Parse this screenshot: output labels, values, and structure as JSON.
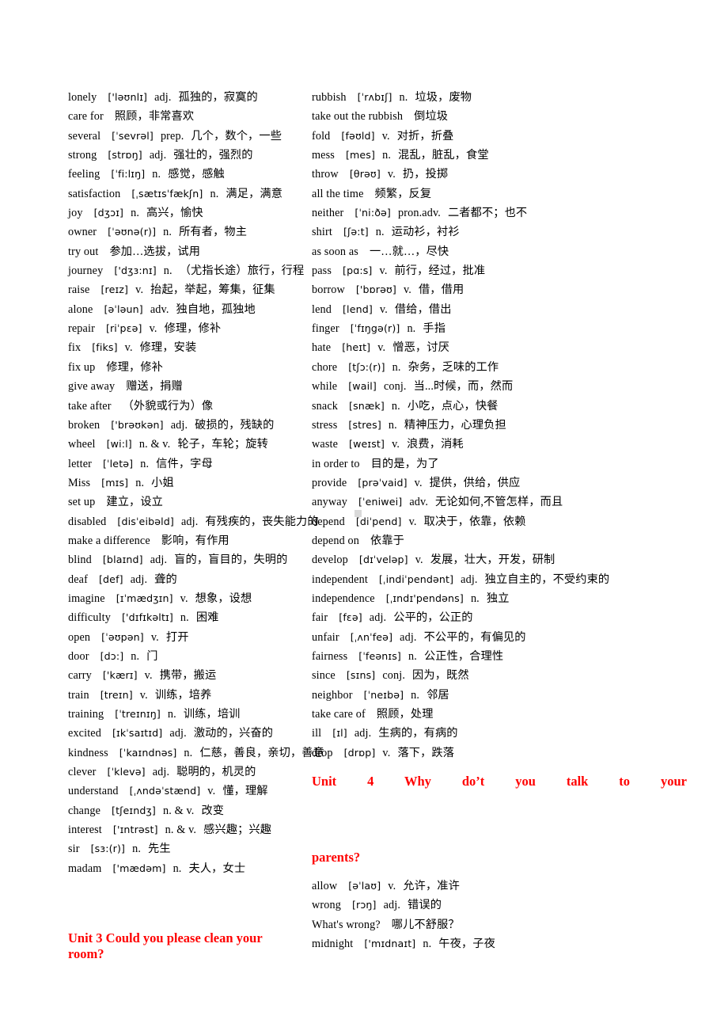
{
  "document": {
    "type": "vocabulary-glossary",
    "language_pair": "English-Chinese",
    "page_background": "#ffffff",
    "heading_color": "#ff0000",
    "body_color": "#000000"
  },
  "left_column": {
    "entries": [
      {
        "word": "lonely",
        "phonetic": "['ləʊnlɪ]",
        "pos": "adj.",
        "meaning": "孤独的，寂寞的"
      },
      {
        "word": "care for",
        "phonetic": "",
        "pos": "",
        "meaning": "照顾，非常喜欢"
      },
      {
        "word": "several",
        "phonetic": "[ˈsevrəl]",
        "pos": "prep.",
        "meaning": "几个，数个，一些"
      },
      {
        "word": "strong",
        "phonetic": "[strɒŋ]",
        "pos": "adj.",
        "meaning": "强壮的，强烈的"
      },
      {
        "word": "feeling",
        "phonetic": "[ˈfi:lɪŋ]",
        "pos": "n.",
        "meaning": "感觉，感触"
      },
      {
        "word": "satisfaction",
        "phonetic": "[ˌsætɪsˈfækʃn]",
        "pos": "n.",
        "meaning": "满足，满意"
      },
      {
        "word": "joy",
        "phonetic": "[dʒɔɪ]",
        "pos": "n.",
        "meaning": "高兴，愉快"
      },
      {
        "word": "owner",
        "phonetic": "[ˈəʊnə(r)]",
        "pos": "n.",
        "meaning": "所有者，物主"
      },
      {
        "word": "try out",
        "phonetic": "",
        "pos": "",
        "meaning": "参加…选拔，试用"
      },
      {
        "word": "journey",
        "phonetic": "['dʒɜ:nɪ]",
        "pos": "n.",
        "meaning": "（尤指长途）旅行，行程"
      },
      {
        "word": "raise",
        "phonetic": "[reɪz]",
        "pos": "v.",
        "meaning": "抬起，举起，筹集，征集"
      },
      {
        "word": "alone",
        "phonetic": "[əˈləun]",
        "pos": "adv.",
        "meaning": "独自地，孤独地"
      },
      {
        "word": "repair",
        "phonetic": "[riˈpɛə]",
        "pos": "v.",
        "meaning": "修理，修补"
      },
      {
        "word": "fix",
        "phonetic": "[fiks]",
        "pos": "v.",
        "meaning": "修理，安装"
      },
      {
        "word": "fix up",
        "phonetic": "",
        "pos": "",
        "meaning": "修理，修补"
      },
      {
        "word": "give away",
        "phonetic": "",
        "pos": "",
        "meaning": "赠送，捐赠"
      },
      {
        "word": "take after",
        "phonetic": "",
        "pos": "",
        "meaning": "（外貌或行为）像"
      },
      {
        "word": "broken",
        "phonetic": "['brəʊkən]",
        "pos": "adj.",
        "meaning": "破损的，残缺的"
      },
      {
        "word": "wheel",
        "phonetic": "[wi:l]",
        "pos": "n. & v.",
        "meaning": "轮子，车轮；旋转"
      },
      {
        "word": "letter",
        "phonetic": "[ˈletə]",
        "pos": "n.",
        "meaning": "信件，字母"
      },
      {
        "word": "Miss",
        "phonetic": "[mɪs]",
        "pos": "n.",
        "meaning": "小姐"
      },
      {
        "word": "set up",
        "phonetic": "",
        "pos": "",
        "meaning": "建立，设立"
      },
      {
        "word": "disabled",
        "phonetic": "[disˈeibəld]",
        "pos": "adj.",
        "meaning": "有残疾的，丧失能力的"
      },
      {
        "word": "make a difference",
        "phonetic": "",
        "pos": "",
        "meaning": "影响，有作用"
      },
      {
        "word": "blind",
        "phonetic": "[blaɪnd]",
        "pos": "adj.",
        "meaning": "盲的，盲目的，失明的"
      },
      {
        "word": "deaf",
        "phonetic": "[def]",
        "pos": "adj.",
        "meaning": "聋的"
      },
      {
        "word": "imagine",
        "phonetic": "[ɪˈmædʒɪn]",
        "pos": "v.",
        "meaning": "想象，设想"
      },
      {
        "word": "difficulty",
        "phonetic": "['dɪfɪkəltɪ]",
        "pos": "n.",
        "meaning": "困难"
      },
      {
        "word": "open",
        "phonetic": "[ˈəʊpən]",
        "pos": "v.",
        "meaning": "打开"
      },
      {
        "word": "door",
        "phonetic": "[dɔ:]",
        "pos": "n.",
        "meaning": "门"
      },
      {
        "word": "carry",
        "phonetic": "['kærɪ]",
        "pos": "v.",
        "meaning": "携带，搬运"
      },
      {
        "word": "train",
        "phonetic": "[treɪn]",
        "pos": "v.",
        "meaning": "训练，培养"
      },
      {
        "word": "training",
        "phonetic": "[ˈtreɪnɪŋ]",
        "pos": "n.",
        "meaning": "训练，培训"
      },
      {
        "word": "excited",
        "phonetic": "[ɪkˈsaɪtɪd]",
        "pos": "adj.",
        "meaning": "激动的，兴奋的"
      },
      {
        "word": "kindness",
        "phonetic": "[ˈkaɪndnəs]",
        "pos": "n.",
        "meaning": "仁慈，善良，亲切，善意"
      },
      {
        "word": "clever",
        "phonetic": "[ˈklevə]",
        "pos": "adj.",
        "meaning": "聪明的，机灵的"
      },
      {
        "word": "understand",
        "phonetic": "[ˌʌndəˈstænd]",
        "pos": "v.",
        "meaning": "懂，理解"
      },
      {
        "word": "change",
        "phonetic": "[tʃeɪndʒ]",
        "pos": "n. & v.",
        "meaning": "改变"
      },
      {
        "word": "interest",
        "phonetic": "['ɪntrəst]",
        "pos": "n. & v.",
        "meaning": "感兴趣；兴趣"
      },
      {
        "word": "sir",
        "phonetic": "[sɜ:(r)]",
        "pos": "n.",
        "meaning": "先生"
      },
      {
        "word": "madam",
        "phonetic": "['mædəm]",
        "pos": "n.",
        "meaning": "夫人，女士"
      }
    ],
    "unit_heading": "Unit 3 Could you please clean your room?"
  },
  "right_column": {
    "entries": [
      {
        "word": " rubbish",
        "phonetic": "[ˈrʌbɪʃ]",
        "pos": "n.",
        "meaning": "垃圾，废物"
      },
      {
        "word": "take out the rubbish",
        "phonetic": "",
        "pos": "",
        "meaning": "倒垃圾"
      },
      {
        "word": "fold",
        "phonetic": "[fəʊld]",
        "pos": "v.",
        "meaning": "对折，折叠"
      },
      {
        "word": "mess",
        "phonetic": "[mes]",
        "pos": "n.",
        "meaning": "混乱，脏乱，食堂"
      },
      {
        "word": "throw",
        "phonetic": "[θrəʊ]",
        "pos": "v.",
        "meaning": "扔，投掷"
      },
      {
        "word": "all the time",
        "phonetic": "",
        "pos": "",
        "meaning": "频繁，反复"
      },
      {
        "word": "neither",
        "phonetic": "[ˈni:ðə]",
        "pos": "pron.adv.",
        "meaning": "二者都不；也不"
      },
      {
        "word": "shirt",
        "phonetic": "[ʃə:t]",
        "pos": "n.",
        "meaning": "运动衫，衬衫"
      },
      {
        "word": "as soon as",
        "phonetic": "",
        "pos": "",
        "meaning": "一…就…，尽快"
      },
      {
        "word": "pass",
        "phonetic": "[pɑ:s]",
        "pos": "v.",
        "meaning": "前行，经过，批准"
      },
      {
        "word": "borrow",
        "phonetic": "['bɒrəʊ]",
        "pos": "v.",
        "meaning": "借，借用"
      },
      {
        "word": "lend",
        "phonetic": "[lend]",
        "pos": "v.",
        "meaning": "借给，借出"
      },
      {
        "word": "finger",
        "phonetic": "[ˈfɪŋgə(r)]",
        "pos": "n.",
        "meaning": "手指"
      },
      {
        "word": "hate",
        "phonetic": "[heɪt]",
        "pos": "v.",
        "meaning": "憎恶，讨厌"
      },
      {
        "word": "chore",
        "phonetic": "[tʃɔ:(r)]",
        "pos": "n.",
        "meaning": "杂务，乏味的工作"
      },
      {
        "word": "while",
        "phonetic": "[wail]",
        "pos": "conj.",
        "meaning": "当...时候，而，然而"
      },
      {
        "word": "snack",
        "phonetic": "[snæk]",
        "pos": "n.",
        "meaning": "小吃，点心，快餐"
      },
      {
        "word": "stress",
        "phonetic": "[stres]",
        "pos": "n.",
        "meaning": "精神压力，心理负担"
      },
      {
        "word": "waste",
        "phonetic": "[weɪst]",
        "pos": "v.",
        "meaning": "浪费，消耗"
      },
      {
        "word": "in order to",
        "phonetic": "",
        "pos": "",
        "meaning": "目的是，为了"
      },
      {
        "word": "provide",
        "phonetic": "[prəˈvaid]",
        "pos": "v.",
        "meaning": "提供，供给，供应"
      },
      {
        "word": "anyway",
        "phonetic": "[ˈeniwei]",
        "pos": "adv.",
        "meaning": "无论如何,不管怎样，而且"
      },
      {
        "word": "depend",
        "phonetic": "[diˈpend]",
        "pos": "v.",
        "meaning": "取决于，依靠，依赖"
      },
      {
        "word": "depend on",
        "phonetic": "",
        "pos": "",
        "meaning": "依靠于"
      },
      {
        "word": "develop",
        "phonetic": "[dɪˈveləp]",
        "pos": "v.",
        "meaning": "发展，壮大，开发，研制"
      },
      {
        "word": "independent",
        "phonetic": "[ˌindiˈpendənt]",
        "pos": "adj.",
        "meaning": "独立自主的，不受约束的",
        "wraps": true
      },
      {
        "word": "independence",
        "phonetic": "[ˌɪndɪ'pendəns]",
        "pos": "n.",
        "meaning": "独立"
      },
      {
        "word": "fair",
        "phonetic": "[fɛə]",
        "pos": "adj.",
        "meaning": "公平的，公正的"
      },
      {
        "word": "unfair",
        "phonetic": "[ˌʌnˈfeə]",
        "pos": "adj.",
        "meaning": "不公平的，有偏见的"
      },
      {
        "word": "fairness",
        "phonetic": "[ˈfeənɪs]",
        "pos": "n.",
        "meaning": "公正性，合理性"
      },
      {
        "word": "since",
        "phonetic": "[sɪns]",
        "pos": "conj.",
        "meaning": "因为，既然"
      },
      {
        "word": "neighbor",
        "phonetic": "[ˈneɪbə]",
        "pos": "n.",
        "meaning": "邻居"
      },
      {
        "word": "take care of",
        "phonetic": "",
        "pos": "",
        "meaning": "照顾，处理"
      },
      {
        "word": "ill",
        "phonetic": "[ɪl]",
        "pos": "adj.",
        "meaning": "生病的，有病的"
      },
      {
        "word": "drop",
        "phonetic": "[drɒp]",
        "pos": "v.",
        "meaning": "落下，跌落"
      }
    ],
    "unit_heading_line1": "Unit 4 Why do’t you talk to your",
    "unit_heading_line2": "parents?",
    "entries_after_heading": [
      {
        "word": " allow",
        "phonetic": "[əˈlaʊ]",
        "pos": "v.",
        "meaning": "允许，准许"
      },
      {
        "word": "wrong",
        "phonetic": "[rɔŋ]",
        "pos": "adj.",
        "meaning": "错误的"
      },
      {
        "word": "What's wrong?",
        "phonetic": "",
        "pos": "",
        "meaning": "哪儿不舒服？"
      },
      {
        "word": "midnight",
        "phonetic": "['mɪdnaɪt]",
        "pos": "n.",
        "meaning": "午夜，子夜"
      }
    ]
  }
}
